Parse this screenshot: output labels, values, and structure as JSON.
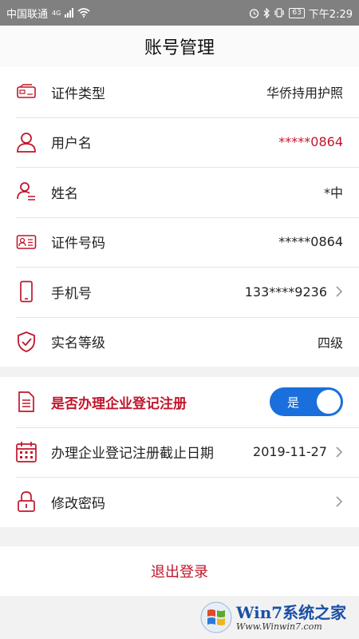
{
  "status_bar": {
    "carrier": "中国联通",
    "network": "4G",
    "battery": "63",
    "time": "下午2:29"
  },
  "header": {
    "title": "账号管理"
  },
  "info_rows": [
    {
      "label": "证件类型",
      "value": "华侨持用护照",
      "icon": "id-card-icon"
    },
    {
      "label": "用户名",
      "value": "*****0864",
      "icon": "user-icon"
    },
    {
      "label": "姓名",
      "value": "*中",
      "icon": "user-name-icon"
    },
    {
      "label": "证件号码",
      "value": "*****0864",
      "icon": "id-number-icon"
    },
    {
      "label": "手机号",
      "value": "133****9236",
      "icon": "phone-icon"
    },
    {
      "label": "实名等级",
      "value": "四级",
      "icon": "shield-check-icon"
    }
  ],
  "enterprise": {
    "label": "是否办理企业登记注册",
    "toggle_label": "是",
    "toggle_on": true,
    "deadline_label": "办理企业登记注册截止日期",
    "deadline_value": "2019-11-27",
    "password_label": "修改密码"
  },
  "logout_label": "退出登录",
  "watermark": {
    "brand": "Win7系统之家",
    "url": "Www.Winwin7.com"
  },
  "colors": {
    "accent": "#c0162c",
    "toggle": "#1a6fdc",
    "status_bar": "#808080"
  }
}
